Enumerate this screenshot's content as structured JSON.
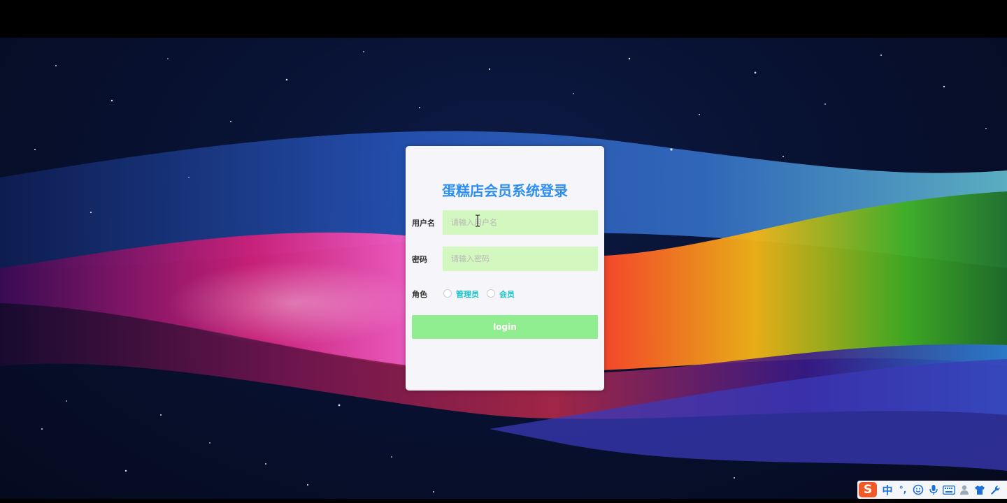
{
  "login": {
    "title": "蛋糕店会员系统登录",
    "username_label": "用户名",
    "username_placeholder": "请输入用户名",
    "password_label": "密码",
    "password_placeholder": "请输入密码",
    "role_label": "角色",
    "role_options": [
      "管理员",
      "会员"
    ],
    "login_button": "login"
  },
  "ime_toolbar": {
    "logo": "S",
    "lang": "中",
    "punct": "°,",
    "icons": [
      "smiley-icon",
      "microphone-icon",
      "keyboard-icon",
      "person-icon",
      "shirt-icon",
      "wrench-icon"
    ]
  },
  "colors": {
    "title": "#2f8ff0",
    "input_bg": "#d2f7bf",
    "button_bg": "#90ee90",
    "radio_label": "#18c3c8",
    "card_bg": "#f6f5f9"
  }
}
